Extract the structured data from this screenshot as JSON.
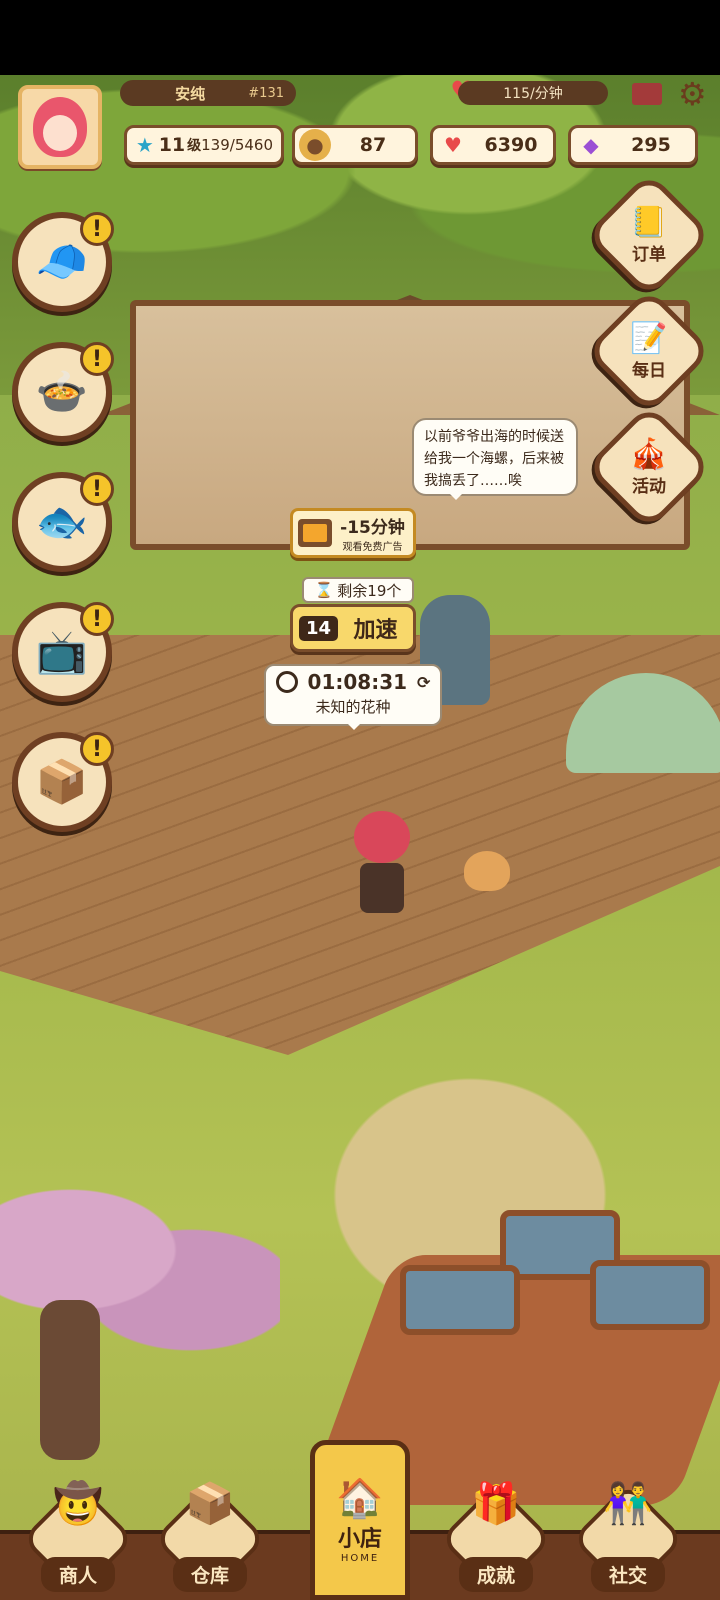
{
  "player": {
    "name": "安纯",
    "id": "#131",
    "income_rate": "115/分钟"
  },
  "stats": {
    "level": "11",
    "level_unit": "级",
    "exp": "139/5460",
    "coins": "87",
    "hearts": "6390",
    "gems": "295"
  },
  "left_buttons": [
    {
      "icon": "customer-icon",
      "alert": "!"
    },
    {
      "icon": "cooking-pot-icon",
      "alert": "!"
    },
    {
      "icon": "fish-icon",
      "alert": "!"
    },
    {
      "icon": "tv-icon",
      "alert": "!"
    },
    {
      "icon": "package-icon",
      "alert": "!"
    }
  ],
  "right_buttons": {
    "orders": {
      "label": "订单",
      "icon": "order-book-icon"
    },
    "daily": {
      "label": "每日",
      "icon": "daily-note-icon"
    },
    "events": {
      "label": "活动",
      "icon": "event-icon"
    }
  },
  "speech": {
    "text": "以前爷爷出海的时候送给我一个海螺，后来被我搞丢了……唉"
  },
  "ad_boost": {
    "line1": "-15分钟",
    "line2": "观看免费广告"
  },
  "speedup": {
    "remaining": "剩余19个",
    "count": "14",
    "label": "加速"
  },
  "timer": {
    "time": "01:08:31",
    "item": "未知的花种"
  },
  "bottom_nav": {
    "merchant": "商人",
    "warehouse": "仓库",
    "shop": "小店",
    "shop_sub": "HOME",
    "achievements": "成就",
    "social": "社交"
  },
  "colors": {
    "frame_brown": "#6f3f22",
    "panel_cream": "#f6e2bc",
    "alert_yellow": "#f5c42a",
    "speed_yellow": "#f8d86b"
  }
}
